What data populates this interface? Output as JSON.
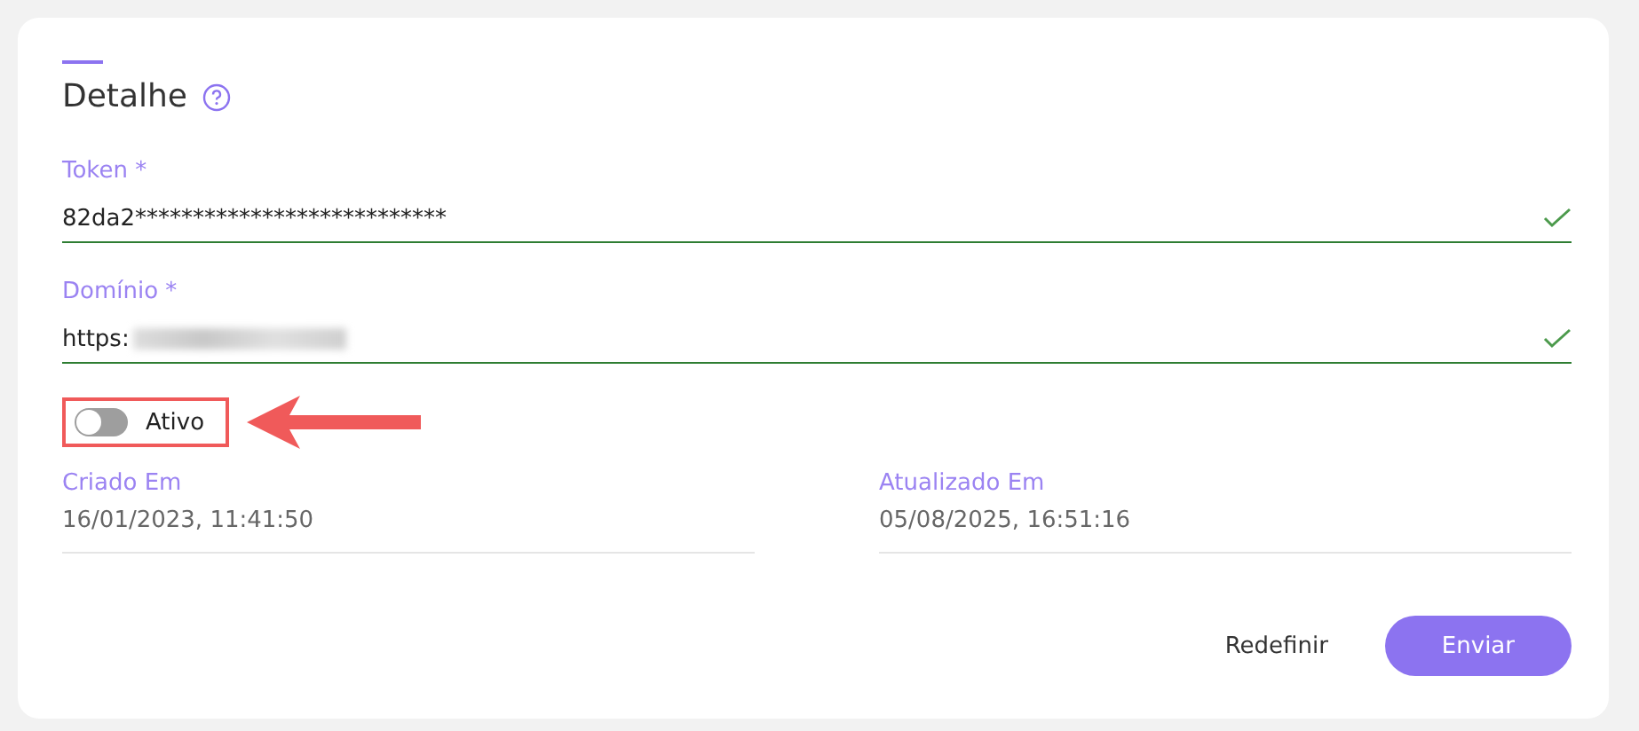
{
  "title": "Detalhe",
  "fields": [
    {
      "label": "Token *",
      "value": "82da2***************************",
      "valid": true,
      "redacted": false
    },
    {
      "label": "Domínio *",
      "value": "https:",
      "valid": true,
      "redacted": true
    }
  ],
  "toggle": {
    "label": "Ativo",
    "on": false,
    "highlighted": true
  },
  "meta": [
    {
      "label": "Criado Em",
      "value": "16/01/2023, 11:41:50"
    },
    {
      "label": "Atualizado Em",
      "value": "05/08/2025, 16:51:16"
    }
  ],
  "buttons": [
    {
      "label": "Redefinir",
      "kind": "text"
    },
    {
      "label": "Enviar",
      "kind": "primary"
    }
  ]
}
